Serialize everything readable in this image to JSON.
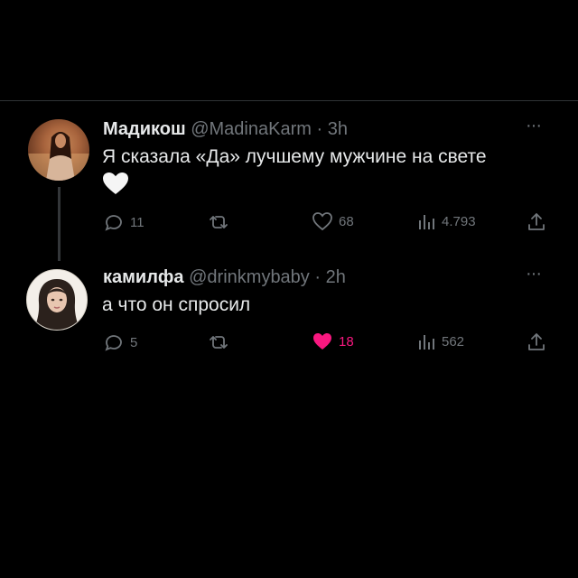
{
  "tweets": [
    {
      "name": "Мадикош",
      "handle": "@MadinaKarm",
      "sep": "·",
      "time": "3h",
      "more": "···",
      "text": "Я сказала «Да» лучшему мужчине на свете",
      "emoji": "🤍",
      "replies": "11",
      "likes": "68",
      "views": "4.793",
      "liked": false
    },
    {
      "name": "камилфа",
      "handle": "@drinkmybaby",
      "sep": "·",
      "time": "2h",
      "more": "···",
      "text": "а что он спросил",
      "replies": "5",
      "likes": "18",
      "views": "562",
      "liked": true
    }
  ],
  "colors": {
    "background": "#000000",
    "text": "#e7e9ea",
    "muted": "#71767b",
    "like_active": "#f91880",
    "divider": "#2f3336"
  },
  "icons": [
    "reply-icon",
    "retweet-icon",
    "heart-icon",
    "views-icon",
    "share-icon",
    "more-icon"
  ]
}
